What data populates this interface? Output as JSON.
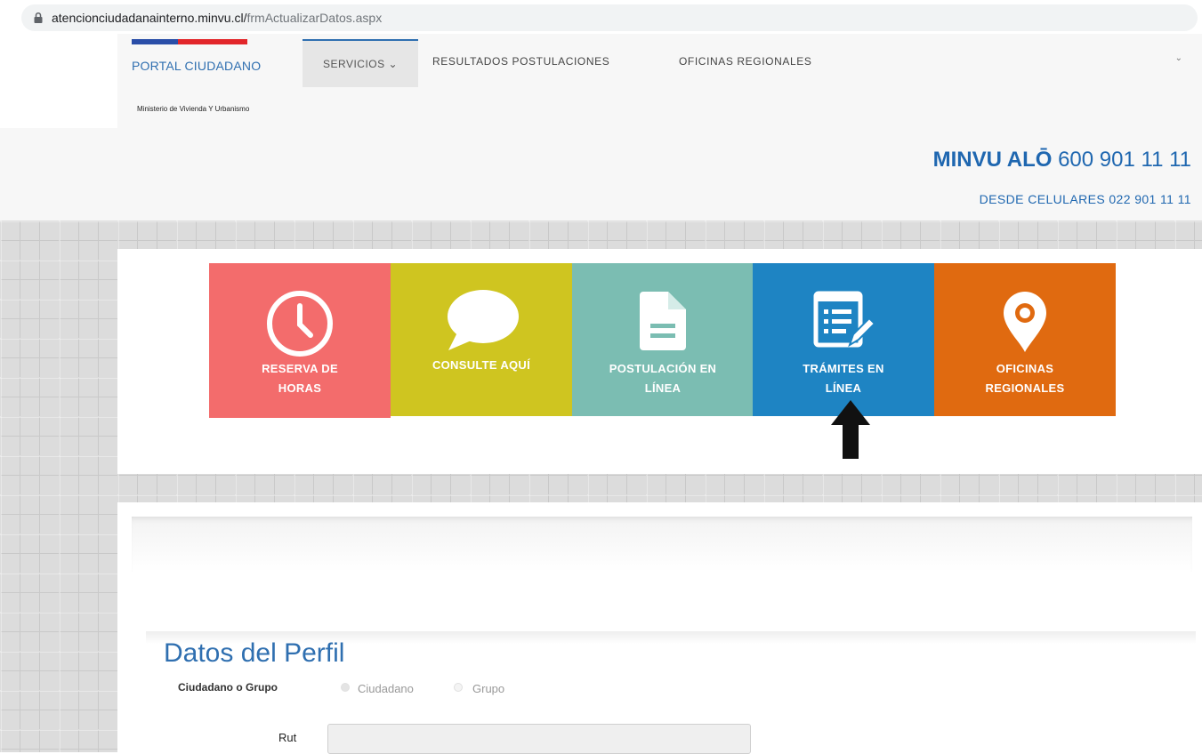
{
  "browser": {
    "url_host": "atencionciudadanainterno.minvu.cl/",
    "url_path": "frmActualizarDatos.aspx"
  },
  "nav": {
    "portal": "PORTAL CIUDADANO",
    "ministry": "Ministerio de Vivienda Y Urbanismo",
    "servicios": "SERVICIOS ⌄",
    "resultados": "RESULTADOS POSTULACIONES",
    "oficinas": "OFICINAS REGIONALES",
    "caret": "⌄"
  },
  "contact": {
    "brand": "MINVU ALŌ",
    "number": " 600 901 11 11",
    "cell": "DESDE CELULARES 022 901 11 11"
  },
  "tiles": [
    {
      "label_1": "RESERVA DE",
      "label_2": "HORAS",
      "icon": "clock-icon",
      "color": "#f36c6c"
    },
    {
      "label_1": "CONSULTE AQUÍ",
      "label_2": "",
      "icon": "speech-bubble-icon",
      "color": "#cfc520"
    },
    {
      "label_1": "POSTULACIÓN EN",
      "label_2": "LÍNEA",
      "icon": "document-icon",
      "color": "#7bbdb2"
    },
    {
      "label_1": "TRÁMITES EN",
      "label_2": "LÍNEA",
      "icon": "form-edit-icon",
      "color": "#1e84c3"
    },
    {
      "label_1": "OFICINAS",
      "label_2": "REGIONALES",
      "icon": "map-pin-icon",
      "color": "#e06a10"
    }
  ],
  "form": {
    "title": "Datos del Perfil",
    "type_label": "Ciudadano o Grupo",
    "option_ciudadano": "Ciudadano",
    "option_grupo": "Grupo",
    "rut_label": "Rut",
    "rut_value": ""
  }
}
